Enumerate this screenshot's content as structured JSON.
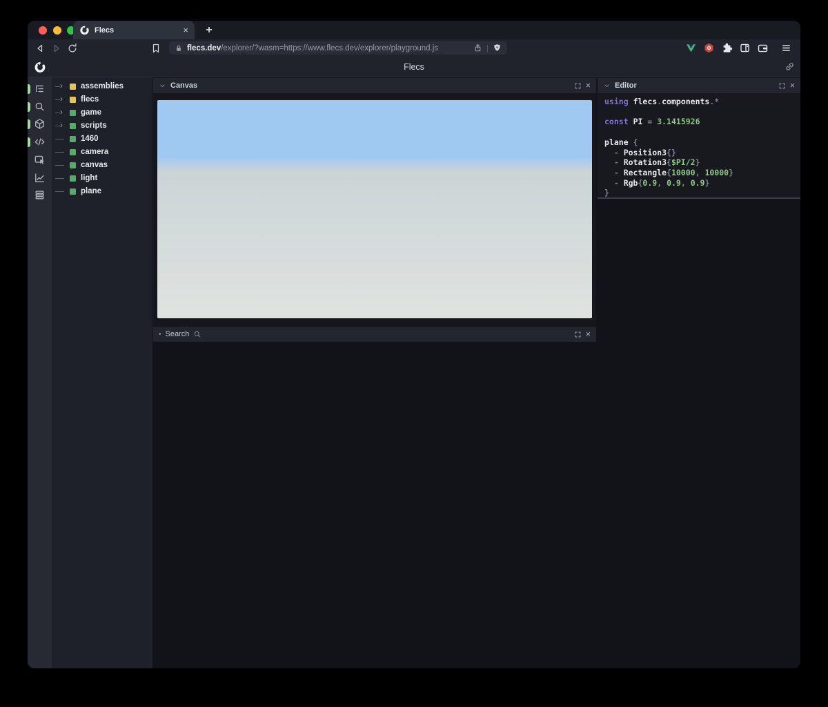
{
  "browser": {
    "traffic_lights": [
      "#ff5f57",
      "#febc2e",
      "#28c840"
    ],
    "tab": {
      "title": "Flecs",
      "favicon": "flecs-logo-icon",
      "close_label": "×"
    },
    "new_tab_label": "+",
    "nav": {
      "back_icon": "back-icon",
      "forward_icon": "forward-icon",
      "reload_icon": "reload-icon",
      "bookmark_icon": "bookmark-icon"
    },
    "address": {
      "lock_icon": "lock-icon",
      "domain": "flecs.dev",
      "path": "/explorer/?wasm=https://www.flecs.dev/explorer/playground.js",
      "share_icon": "share-icon",
      "divider": "|",
      "shield_icon": "brave-shield-icon"
    },
    "extensions": [
      {
        "name": "vue-devtools",
        "icon": "vue-icon"
      },
      {
        "name": "hexagon-extension",
        "icon": "hexagon-icon"
      },
      {
        "name": "extensions",
        "icon": "puzzle-icon"
      },
      {
        "name": "sidebar",
        "icon": "sidebar-icon"
      },
      {
        "name": "wallet",
        "icon": "wallet-icon"
      }
    ],
    "menu_icon": "menu-icon"
  },
  "app": {
    "header": {
      "logo_icon": "flecs-logo-icon",
      "title": "Flecs",
      "link_icon": "link-icon"
    },
    "toolbar": [
      {
        "name": "entity-tree",
        "icon": "tree-icon",
        "active": true
      },
      {
        "name": "query-search",
        "icon": "search-icon",
        "active": true
      },
      {
        "name": "entities",
        "icon": "cube-icon",
        "active": true
      },
      {
        "name": "scripts",
        "icon": "code-icon",
        "active": true
      },
      {
        "name": "inspector",
        "icon": "inspector-icon",
        "active": false
      },
      {
        "name": "statistics",
        "icon": "chart-icon",
        "active": false
      },
      {
        "name": "tables",
        "icon": "rows-icon",
        "active": false
      }
    ],
    "tree": {
      "items": [
        {
          "label": "assemblies",
          "expandable": true,
          "color": "#e7c64b"
        },
        {
          "label": "flecs",
          "expandable": true,
          "color": "#e7c64b"
        },
        {
          "label": "game",
          "expandable": true,
          "color": "#55ac64"
        },
        {
          "label": "scripts",
          "expandable": true,
          "color": "#55ac64"
        },
        {
          "label": "1460",
          "expandable": false,
          "color": "#55ac64"
        },
        {
          "label": "camera",
          "expandable": false,
          "color": "#55ac64"
        },
        {
          "label": "canvas",
          "expandable": false,
          "color": "#55ac64"
        },
        {
          "label": "light",
          "expandable": false,
          "color": "#55ac64"
        },
        {
          "label": "plane",
          "expandable": false,
          "color": "#55ac64"
        }
      ],
      "expand_arrow": "›"
    },
    "canvas_panel": {
      "title": "Canvas",
      "collapse_icon": "chevron-down-icon",
      "fullscreen_icon": "fullscreen-icon",
      "close_label": "×",
      "sky_color": "#a0c9f1",
      "horizon_pct": 26,
      "ground_top": "#ccd4d6",
      "ground_bottom": "#dfe3e0"
    },
    "search_panel": {
      "bullet": "•",
      "title": "Search",
      "search_icon": "magnifier-icon",
      "fullscreen_icon": "fullscreen-icon",
      "close_label": "×"
    },
    "editor_panel": {
      "title": "Editor",
      "collapse_icon": "chevron-down-icon",
      "fullscreen_icon": "fullscreen-icon",
      "close_label": "×",
      "code": {
        "lines": [
          {
            "tokens": [
              [
                "using",
                "kw"
              ],
              [
                " ",
                "pu"
              ],
              [
                "flecs",
                "id"
              ],
              [
                ".",
                "pu"
              ],
              [
                "components",
                "id"
              ],
              [
                ".*",
                "pu"
              ]
            ]
          },
          {
            "tokens": []
          },
          {
            "tokens": [
              [
                "const",
                "kw"
              ],
              [
                " ",
                "pu"
              ],
              [
                "PI",
                "id"
              ],
              [
                " = ",
                "pu"
              ],
              [
                "3.1415926",
                "num"
              ]
            ]
          },
          {
            "tokens": []
          },
          {
            "tokens": [
              [
                "plane",
                "id"
              ],
              [
                " ",
                "pu"
              ],
              [
                "{",
                "pu"
              ]
            ]
          },
          {
            "tokens": [
              [
                "  - ",
                "pu"
              ],
              [
                "Position3",
                "id"
              ],
              [
                "{}",
                "pu"
              ]
            ]
          },
          {
            "tokens": [
              [
                "  - ",
                "pu"
              ],
              [
                "Rotation3",
                "id"
              ],
              [
                "{",
                "pu"
              ],
              [
                "$PI/2",
                "num"
              ],
              [
                "}",
                "pu"
              ]
            ]
          },
          {
            "tokens": [
              [
                "  - ",
                "pu"
              ],
              [
                "Rectangle",
                "id"
              ],
              [
                "{",
                "pu"
              ],
              [
                "10000",
                "num"
              ],
              [
                ", ",
                "pu"
              ],
              [
                "10000",
                "num"
              ],
              [
                "}",
                "pu"
              ]
            ]
          },
          {
            "tokens": [
              [
                "  - ",
                "pu"
              ],
              [
                "Rgb",
                "id"
              ],
              [
                "{",
                "pu"
              ],
              [
                "0.9",
                "num"
              ],
              [
                ", ",
                "pu"
              ],
              [
                "0.9",
                "num"
              ],
              [
                ", ",
                "pu"
              ],
              [
                "0.9",
                "num"
              ],
              [
                "}",
                "pu"
              ]
            ]
          },
          {
            "tokens": [
              [
                "}",
                "pu"
              ]
            ]
          }
        ]
      }
    }
  }
}
